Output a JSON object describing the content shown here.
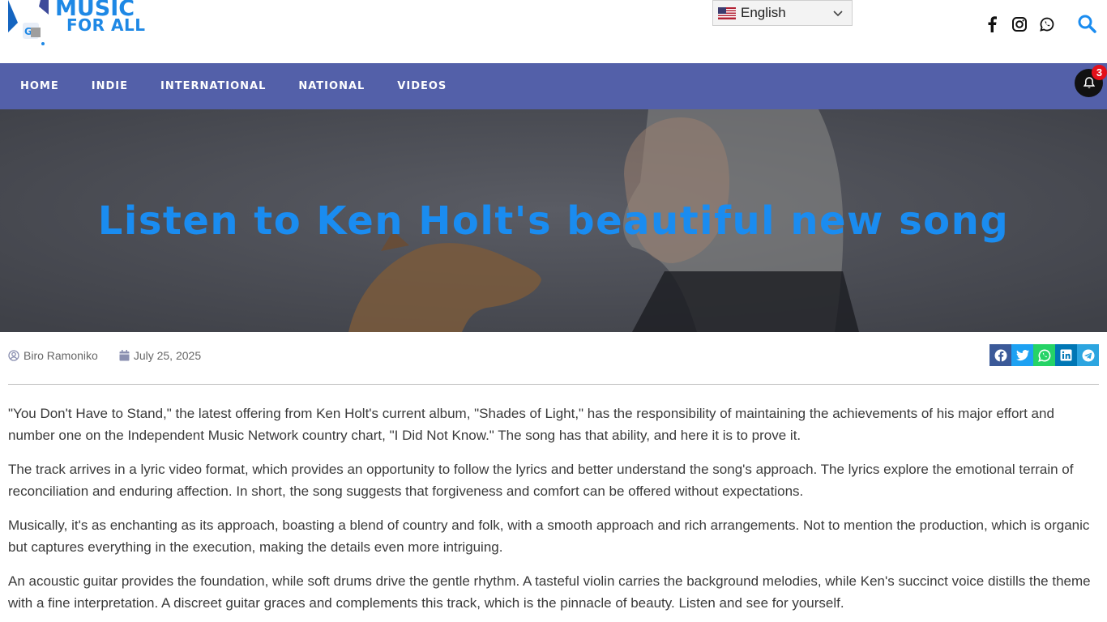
{
  "header": {
    "logo_line1": "MUSIC",
    "logo_line2": "FOR ALL",
    "language": "English",
    "social_icons": [
      "facebook-icon",
      "instagram-icon",
      "whatsapp-icon"
    ],
    "search_icon": "search-icon"
  },
  "nav": {
    "items": [
      "HOME",
      "INDIE",
      "INTERNATIONAL",
      "NATIONAL",
      "VIDEOS"
    ],
    "notification_count": "3"
  },
  "hero": {
    "title": "Listen to Ken Holt's beautiful new song"
  },
  "meta": {
    "author": "Biro Ramoniko",
    "date": "July 25, 2025"
  },
  "share_icons": [
    "facebook-icon",
    "twitter-icon",
    "whatsapp-icon",
    "linkedin-icon",
    "telegram-icon"
  ],
  "article": {
    "paragraphs": [
      "\"You Don't Have to Stand,\" the latest offering from Ken Holt's current album, \"Shades of Light,\" has the responsibility of maintaining the achievements of his major effort and number one on the Independent Music Network country chart, \"I Did Not Know.\" The song has that ability, and here it is to prove it.",
      "The track arrives in a lyric video format, which provides an opportunity to follow the lyrics and better understand the song's approach. The lyrics explore the emotional terrain of reconciliation and enduring affection. In short, the song suggests that forgiveness and comfort can be offered without expectations.",
      "Musically, it's as enchanting as its approach, boasting a blend of country and folk, with a smooth approach and rich arrangements. Not to mention the production, which is organic but captures everything in the execution, making the details even more intriguing.",
      "An acoustic guitar provides the foundation, while soft drums drive the gentle rhythm. A tasteful violin carries the background melodies, while Ken's succinct voice distills the theme with a fine interpretation. A discreet guitar graces and complements this track, which is the pinnacle of beauty. Listen and see for yourself."
    ]
  },
  "colors": {
    "nav_bg": "#5360a9",
    "accent": "#1a8cf0",
    "badge": "#e3101a",
    "facebook": "#3b5998",
    "twitter": "#1da1f2",
    "whatsapp": "#25d366",
    "linkedin": "#0077b5",
    "telegram": "#2ca5e0"
  }
}
